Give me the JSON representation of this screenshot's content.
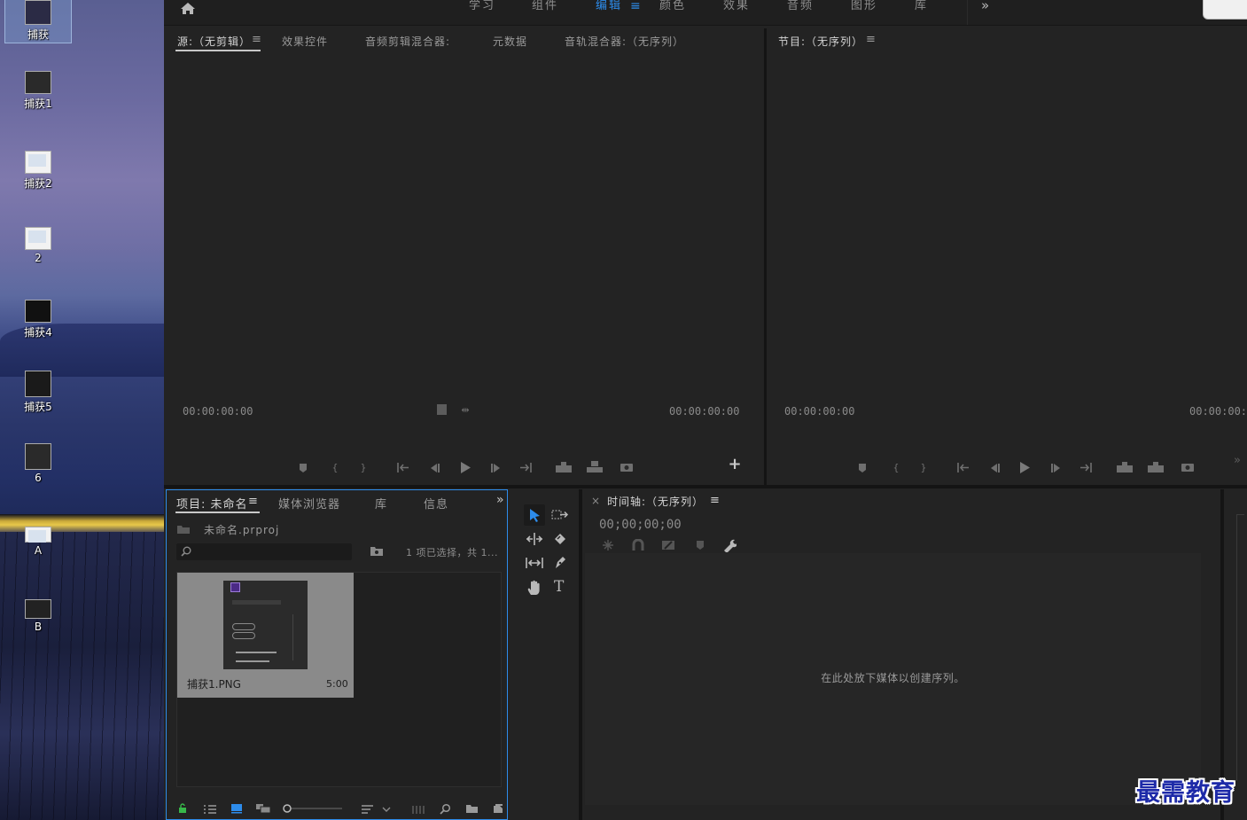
{
  "desktop": {
    "icons": [
      {
        "label": "捕获"
      },
      {
        "label": "捕获1"
      },
      {
        "label": "捕获2"
      },
      {
        "label": "2"
      },
      {
        "label": "捕获4"
      },
      {
        "label": "捕获5"
      },
      {
        "label": "6"
      },
      {
        "label": "A"
      },
      {
        "label": "B"
      }
    ]
  },
  "workspaces": [
    "学习",
    "组件",
    "编辑",
    "颜色",
    "效果",
    "音频",
    "图形",
    "库"
  ],
  "active_workspace": "编辑",
  "overflow_glyph": "»",
  "menu_glyph": "≡",
  "source_panel": {
    "tabs": [
      "源:（无剪辑）",
      "效果控件",
      "音频剪辑混合器:",
      "元数据",
      "音轨混合器:（无序列）"
    ],
    "timecode_left": "00:00:00:00",
    "timecode_right": "00:00:00:00",
    "add_glyph": "+"
  },
  "program_panel": {
    "title": "节目:（无序列）",
    "timecode_left": "00:00:00:00",
    "timecode_right": "00:00:00:"
  },
  "project_panel": {
    "tabs": [
      "项目: 未命名",
      "媒体浏览器",
      "库",
      "信息"
    ],
    "file_name": "未命名.prproj",
    "selection_status": "1 项已选择，共 1...",
    "item": {
      "name": "捕获1.PNG",
      "duration": "5:00"
    }
  },
  "tools": {
    "type_glyph": "T"
  },
  "timeline_panel": {
    "close_glyph": "×",
    "title": "时间轴:（无序列）",
    "timecode": "00;00;00;00",
    "empty_message": "在此处放下媒体以创建序列。"
  },
  "watermark": "最需教育",
  "colors": {
    "accent": "#2d8ceb",
    "panel_bg": "#232323",
    "active_panel_border": "#2d8ceb"
  }
}
